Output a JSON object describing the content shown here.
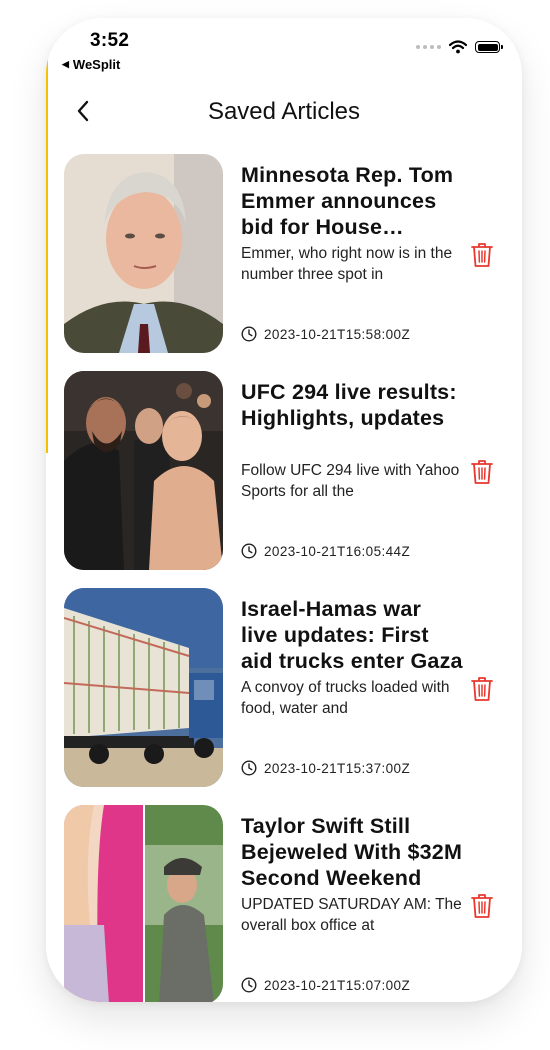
{
  "status_bar": {
    "time": "3:52",
    "return_app": "WeSplit"
  },
  "nav": {
    "title": "Saved Articles"
  },
  "colors": {
    "delete": "#e8382f",
    "accent_edge": "#f3c100"
  },
  "articles": [
    {
      "title": "Minnesota Rep. Tom Emmer announces bid for House Speaker",
      "description": "Emmer, who right now is in the number three spot in",
      "published_at": "2023-10-21T15:58:00Z"
    },
    {
      "title": "UFC 294 live results: Highlights, updates",
      "description": "Follow UFC 294 live with Yahoo Sports for all the",
      "published_at": "2023-10-21T16:05:44Z"
    },
    {
      "title": "Israel-Hamas war live updates: First aid trucks enter Gaza",
      "description": "A convoy of trucks loaded with food, water and",
      "published_at": "2023-10-21T15:37:00Z"
    },
    {
      "title": "Taylor Swift Still Bejeweled With $32M Second Weekend",
      "description": "UPDATED SATURDAY AM: The overall box office at",
      "published_at": "2023-10-21T15:07:00Z"
    }
  ]
}
